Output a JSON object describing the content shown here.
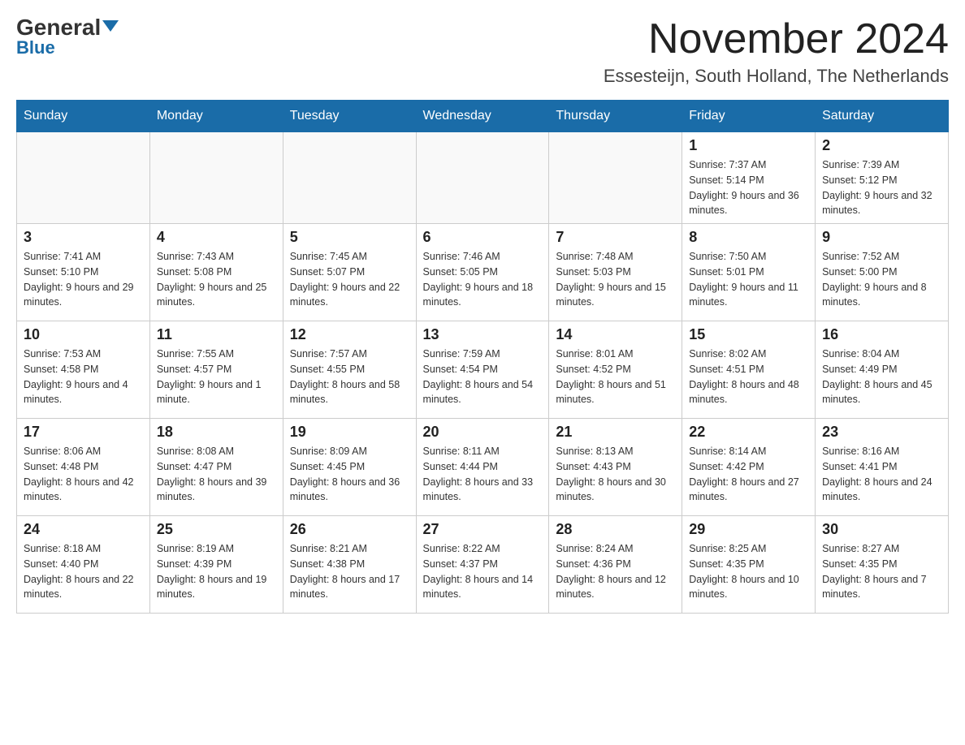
{
  "logo": {
    "text_general": "General",
    "text_blue": "Blue"
  },
  "header": {
    "month": "November 2024",
    "location": "Essesteijn, South Holland, The Netherlands"
  },
  "days_of_week": [
    "Sunday",
    "Monday",
    "Tuesday",
    "Wednesday",
    "Thursday",
    "Friday",
    "Saturday"
  ],
  "weeks": [
    [
      {
        "day": "",
        "info": ""
      },
      {
        "day": "",
        "info": ""
      },
      {
        "day": "",
        "info": ""
      },
      {
        "day": "",
        "info": ""
      },
      {
        "day": "",
        "info": ""
      },
      {
        "day": "1",
        "info": "Sunrise: 7:37 AM\nSunset: 5:14 PM\nDaylight: 9 hours and 36 minutes."
      },
      {
        "day": "2",
        "info": "Sunrise: 7:39 AM\nSunset: 5:12 PM\nDaylight: 9 hours and 32 minutes."
      }
    ],
    [
      {
        "day": "3",
        "info": "Sunrise: 7:41 AM\nSunset: 5:10 PM\nDaylight: 9 hours and 29 minutes."
      },
      {
        "day": "4",
        "info": "Sunrise: 7:43 AM\nSunset: 5:08 PM\nDaylight: 9 hours and 25 minutes."
      },
      {
        "day": "5",
        "info": "Sunrise: 7:45 AM\nSunset: 5:07 PM\nDaylight: 9 hours and 22 minutes."
      },
      {
        "day": "6",
        "info": "Sunrise: 7:46 AM\nSunset: 5:05 PM\nDaylight: 9 hours and 18 minutes."
      },
      {
        "day": "7",
        "info": "Sunrise: 7:48 AM\nSunset: 5:03 PM\nDaylight: 9 hours and 15 minutes."
      },
      {
        "day": "8",
        "info": "Sunrise: 7:50 AM\nSunset: 5:01 PM\nDaylight: 9 hours and 11 minutes."
      },
      {
        "day": "9",
        "info": "Sunrise: 7:52 AM\nSunset: 5:00 PM\nDaylight: 9 hours and 8 minutes."
      }
    ],
    [
      {
        "day": "10",
        "info": "Sunrise: 7:53 AM\nSunset: 4:58 PM\nDaylight: 9 hours and 4 minutes."
      },
      {
        "day": "11",
        "info": "Sunrise: 7:55 AM\nSunset: 4:57 PM\nDaylight: 9 hours and 1 minute."
      },
      {
        "day": "12",
        "info": "Sunrise: 7:57 AM\nSunset: 4:55 PM\nDaylight: 8 hours and 58 minutes."
      },
      {
        "day": "13",
        "info": "Sunrise: 7:59 AM\nSunset: 4:54 PM\nDaylight: 8 hours and 54 minutes."
      },
      {
        "day": "14",
        "info": "Sunrise: 8:01 AM\nSunset: 4:52 PM\nDaylight: 8 hours and 51 minutes."
      },
      {
        "day": "15",
        "info": "Sunrise: 8:02 AM\nSunset: 4:51 PM\nDaylight: 8 hours and 48 minutes."
      },
      {
        "day": "16",
        "info": "Sunrise: 8:04 AM\nSunset: 4:49 PM\nDaylight: 8 hours and 45 minutes."
      }
    ],
    [
      {
        "day": "17",
        "info": "Sunrise: 8:06 AM\nSunset: 4:48 PM\nDaylight: 8 hours and 42 minutes."
      },
      {
        "day": "18",
        "info": "Sunrise: 8:08 AM\nSunset: 4:47 PM\nDaylight: 8 hours and 39 minutes."
      },
      {
        "day": "19",
        "info": "Sunrise: 8:09 AM\nSunset: 4:45 PM\nDaylight: 8 hours and 36 minutes."
      },
      {
        "day": "20",
        "info": "Sunrise: 8:11 AM\nSunset: 4:44 PM\nDaylight: 8 hours and 33 minutes."
      },
      {
        "day": "21",
        "info": "Sunrise: 8:13 AM\nSunset: 4:43 PM\nDaylight: 8 hours and 30 minutes."
      },
      {
        "day": "22",
        "info": "Sunrise: 8:14 AM\nSunset: 4:42 PM\nDaylight: 8 hours and 27 minutes."
      },
      {
        "day": "23",
        "info": "Sunrise: 8:16 AM\nSunset: 4:41 PM\nDaylight: 8 hours and 24 minutes."
      }
    ],
    [
      {
        "day": "24",
        "info": "Sunrise: 8:18 AM\nSunset: 4:40 PM\nDaylight: 8 hours and 22 minutes."
      },
      {
        "day": "25",
        "info": "Sunrise: 8:19 AM\nSunset: 4:39 PM\nDaylight: 8 hours and 19 minutes."
      },
      {
        "day": "26",
        "info": "Sunrise: 8:21 AM\nSunset: 4:38 PM\nDaylight: 8 hours and 17 minutes."
      },
      {
        "day": "27",
        "info": "Sunrise: 8:22 AM\nSunset: 4:37 PM\nDaylight: 8 hours and 14 minutes."
      },
      {
        "day": "28",
        "info": "Sunrise: 8:24 AM\nSunset: 4:36 PM\nDaylight: 8 hours and 12 minutes."
      },
      {
        "day": "29",
        "info": "Sunrise: 8:25 AM\nSunset: 4:35 PM\nDaylight: 8 hours and 10 minutes."
      },
      {
        "day": "30",
        "info": "Sunrise: 8:27 AM\nSunset: 4:35 PM\nDaylight: 8 hours and 7 minutes."
      }
    ]
  ]
}
